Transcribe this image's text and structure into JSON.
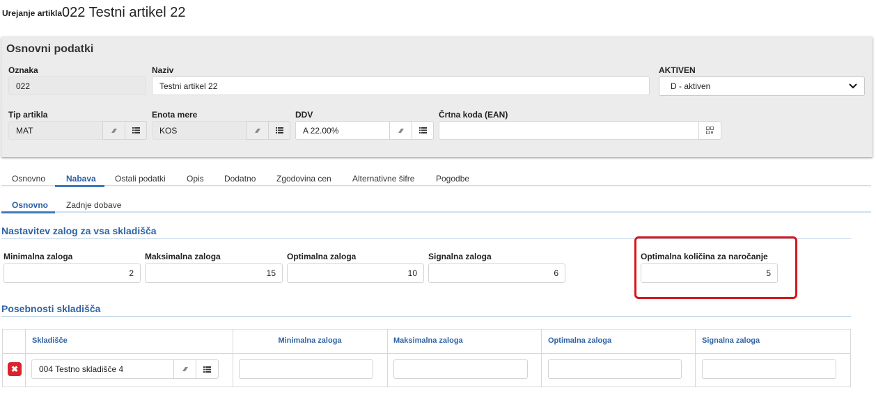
{
  "header": {
    "prefix": "Urejanje artikla",
    "title": "022 Testni artikel 22"
  },
  "basic": {
    "title": "Osnovni podatki",
    "oznaka": {
      "label": "Oznaka",
      "value": "022"
    },
    "naziv": {
      "label": "Naziv",
      "value": "Testni artikel 22"
    },
    "aktiven": {
      "label": "AKTIVEN",
      "value": "D - aktiven"
    },
    "tip": {
      "label": "Tip artikla",
      "value": "MAT"
    },
    "enota": {
      "label": "Enota mere",
      "value": "KOS"
    },
    "ddv": {
      "label": "DDV",
      "value": "A 22.00%"
    },
    "ean": {
      "label": "Črtna koda (EAN)",
      "value": ""
    }
  },
  "tabs": [
    "Osnovno",
    "Nabava",
    "Ostali podatki",
    "Opis",
    "Dodatno",
    "Zgodovina cen",
    "Alternativne šifre",
    "Pogodbe"
  ],
  "active_tab": "Nabava",
  "subtabs": [
    "Osnovno",
    "Zadnje dobave"
  ],
  "active_subtab": "Osnovno",
  "stock": {
    "title": "Nastavitev zalog za vsa skladišča",
    "min": {
      "label": "Minimalna zaloga",
      "value": "2"
    },
    "max": {
      "label": "Maksimalna zaloga",
      "value": "15"
    },
    "opt": {
      "label": "Optimalna zaloga",
      "value": "10"
    },
    "sig": {
      "label": "Signalna zaloga",
      "value": "6"
    },
    "order_qty": {
      "label": "Optimalna količina za naročanje",
      "value": "5"
    }
  },
  "warehouses": {
    "title": "Posebnosti skladišča",
    "columns": [
      "Skladišče",
      "Minimalna zaloga",
      "Maksimalna zaloga",
      "Optimalna zaloga",
      "Signalna zaloga"
    ],
    "rows": [
      {
        "warehouse": "004 Testno skladišče 4",
        "min": "",
        "max": "",
        "opt": "",
        "sig": ""
      }
    ]
  },
  "colors": {
    "accent": "#2f63a6",
    "highlight": "#d6151b",
    "delete": "#d9232d"
  }
}
